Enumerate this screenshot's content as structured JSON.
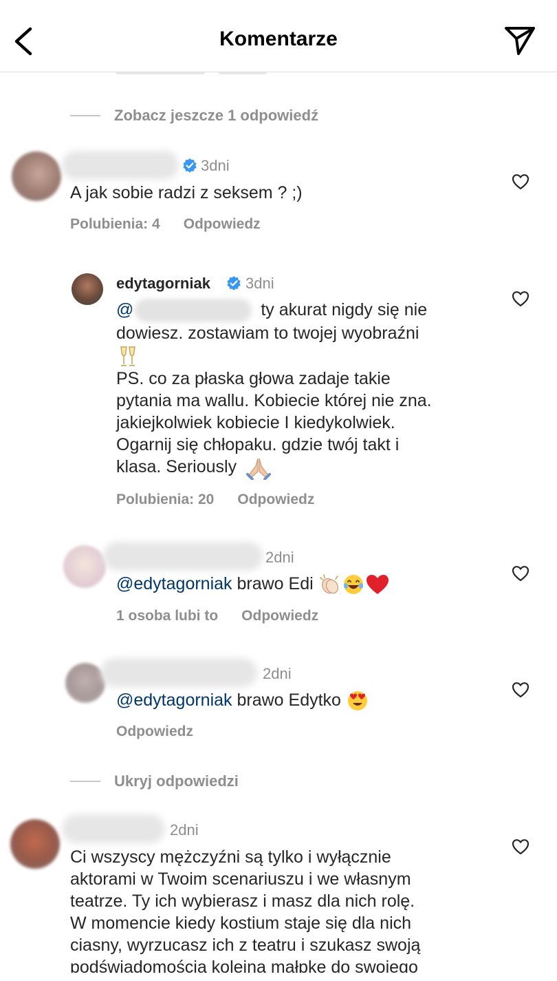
{
  "header": {
    "title": "Komentarze"
  },
  "thread_toggle": {
    "see_more_label": "Zobacz jeszcze 1 odpowiedź",
    "hide_label": "Ukryj odpowiedzi"
  },
  "comments": [
    {
      "time": "3dni",
      "text": "A jak sobie radzi z seksem ? ;)",
      "likes_label": "Polubienia: 4",
      "reply_label": "Odpowiedz"
    },
    {
      "username": "edytagorniak",
      "time": "3dni",
      "mention_prefix": "@",
      "text_after_mention": " ty akurat nigdy się nie",
      "text_line2": "dowiesz. zostawiam to twojej wyobraźni",
      "ps_lines": [
        "PS. co za płaska głowa zadaje takie",
        "pytania ma wallu. Kobiecie której nie zna.",
        "jakiejkolwiek kobiecie I kiedykolwiek.",
        "Ogarnij się  chłopaku. gdzie twój takt i",
        "klasa. Seriously"
      ],
      "likes_label": "Polubienia: 20",
      "reply_label": "Odpowiedz"
    },
    {
      "time": "2dni",
      "mention": "@edytagorniak",
      "text": " brawo Edi ",
      "likes_label": "1 osoba lubi to",
      "reply_label": "Odpowiedz"
    },
    {
      "time": "2dni",
      "mention": "@edytagorniak",
      "text": " brawo Edytko ",
      "reply_label": "Odpowiedz"
    },
    {
      "time": "2dni",
      "lines": [
        "Ci wszyscy mężczyźni są tylko i wyłącznie",
        "aktorami w Twoim scenariuszu i we własnym",
        "teatrze. Ty ich wybierasz i masz dla nich rolę.",
        "W momencie kiedy kostium staje się dla nich",
        "ciasny, wyrzucasz ich z teatru i szukasz swoją",
        "podświadomością kolejną małpkę do swojego"
      ]
    }
  ],
  "icons": [
    "back-arrow-icon",
    "send-icon",
    "verified-badge-icon",
    "heart-icon",
    "champagne-icon",
    "praying-hands-icon",
    "clapping-hands-icon",
    "laughing-emoji-icon",
    "red-heart-icon",
    "heart-eyes-emoji-icon"
  ],
  "colors": {
    "mention": "#00376b",
    "verified": "#3897f0",
    "secondary_text": "#8e8e8e"
  }
}
